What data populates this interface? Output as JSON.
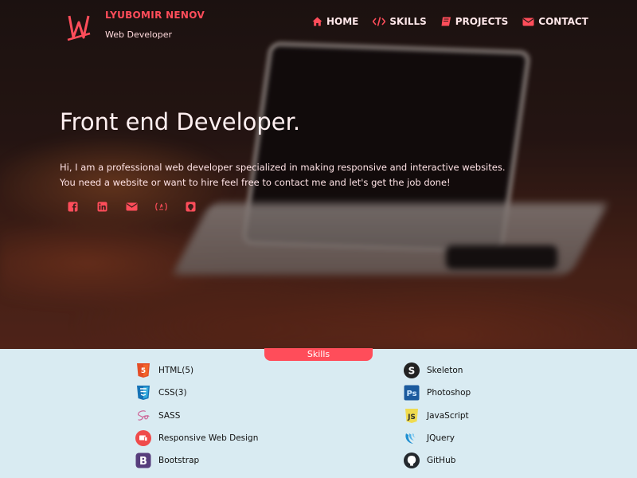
{
  "brand": {
    "name": "LYUBOMIR NENOV",
    "subtitle": "Web Developer"
  },
  "nav": [
    {
      "label": "HOME",
      "icon": "home-icon"
    },
    {
      "label": "SKILLS",
      "icon": "code-icon"
    },
    {
      "label": "PROJECTS",
      "icon": "book-icon"
    },
    {
      "label": "CONTACT",
      "icon": "envelope-icon"
    }
  ],
  "hero": {
    "headline": "Front end Developer.",
    "intro_line1": "Hi, I am a professional web developer specialized in making responsive and interactive websites.",
    "intro_line2": "You need a website or want to hire feel free to contact me and let's get the job done!"
  },
  "social": [
    "facebook-icon",
    "linkedin-icon",
    "envelope-icon",
    "freecodecamp-icon",
    "github-icon"
  ],
  "skills": {
    "tab_label": "Skills",
    "left": [
      {
        "name": "HTML(5)",
        "icon": "html5-icon",
        "color": "#e44d26"
      },
      {
        "name": "CSS(3)",
        "icon": "css3-icon",
        "color": "#1572b6"
      },
      {
        "name": "SASS",
        "icon": "sass-icon",
        "color": "#cd6799"
      },
      {
        "name": "Responsive Web Design",
        "icon": "responsive-icon",
        "color": "#ef4b4b"
      },
      {
        "name": "Bootstrap",
        "icon": "bootstrap-icon",
        "color": "#563d7c"
      }
    ],
    "right": [
      {
        "name": "Skeleton",
        "icon": "skeleton-icon",
        "color": "#222222"
      },
      {
        "name": "Photoshop",
        "icon": "photoshop-icon",
        "color": "#1c5b9e"
      },
      {
        "name": "JavaScript",
        "icon": "javascript-icon",
        "color": "#f0db4f"
      },
      {
        "name": "JQuery",
        "icon": "jquery-icon",
        "color": "#1f8fd1"
      },
      {
        "name": "GitHub",
        "icon": "github-icon",
        "color": "#24292e"
      }
    ]
  },
  "colors": {
    "accent": "#ff4d5a",
    "skills_bg": "#d9ebf2"
  }
}
